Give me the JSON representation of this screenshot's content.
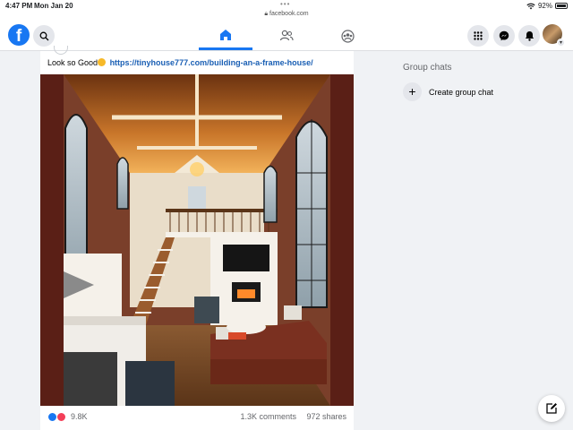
{
  "status_bar": {
    "time": "4:47 PM",
    "date": "Mon Jan 20",
    "url": "facebook.com",
    "battery": "92%",
    "icons": [
      "wifi-icon",
      "battery-icon"
    ]
  },
  "nav": {
    "logo": "f",
    "icons": [
      "search-icon",
      "home-icon",
      "friends-icon",
      "groups-icon",
      "menu-grid-icon",
      "messenger-icon",
      "notifications-icon"
    ],
    "active_tab": "home"
  },
  "post": {
    "text": "Look so Good",
    "link": "https://tinyhouse777.com/building-an-a-frame-house/",
    "reactions_count": "9.8K",
    "comments": "1.3K comments",
    "shares": "972 shares"
  },
  "sidebar": {
    "group_chats_title": "Group chats",
    "create_group_label": "Create group chat"
  },
  "colors": {
    "brand": "#1877f2",
    "background": "#f0f2f5",
    "link": "#1a5fb4",
    "photo_frame": "#5a1f16"
  }
}
